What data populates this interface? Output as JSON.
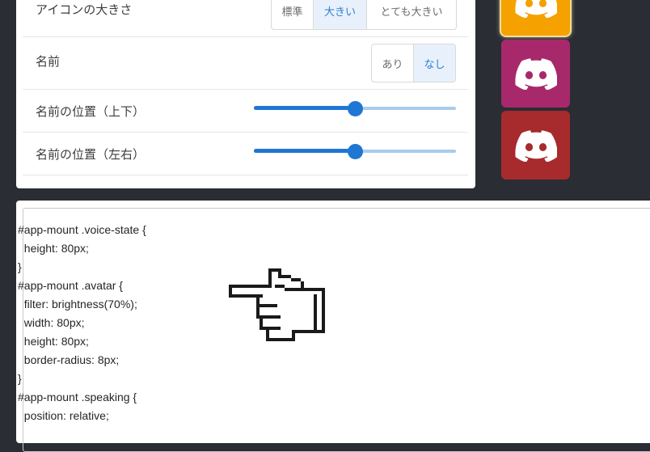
{
  "settings": {
    "icon_size": {
      "label": "アイコンの大きさ",
      "options": [
        "標準",
        "大きい",
        "とても大きい"
      ],
      "selected": "大きい"
    },
    "name": {
      "label": "名前",
      "options": [
        "あり",
        "なし"
      ],
      "selected": "なし"
    },
    "name_position_vertical": {
      "label": "名前の位置（上下）",
      "value_fraction": 0.5
    },
    "name_position_horizontal": {
      "label": "名前の位置（左右）",
      "value_fraction": 0.5
    }
  },
  "avatars": [
    {
      "color": "#f5a100",
      "icon": "discord-icon",
      "highlighted": true
    },
    {
      "color": "#a7296b",
      "icon": "discord-icon",
      "highlighted": false
    },
    {
      "color": "#a72a2d",
      "icon": "discord-icon",
      "highlighted": false
    }
  ],
  "css_editor": {
    "lines": [
      "#app-mount .voice-state {",
      "  height: 80px;",
      "}",
      "#app-mount .avatar {",
      "  filter: brightness(70%);",
      "  width: 80px;",
      "  height: 80px;",
      "  border-radius: 8px;",
      "}",
      "#app-mount .speaking {",
      "  position: relative;"
    ],
    "pointer_icon": "pointing-hand-icon"
  }
}
